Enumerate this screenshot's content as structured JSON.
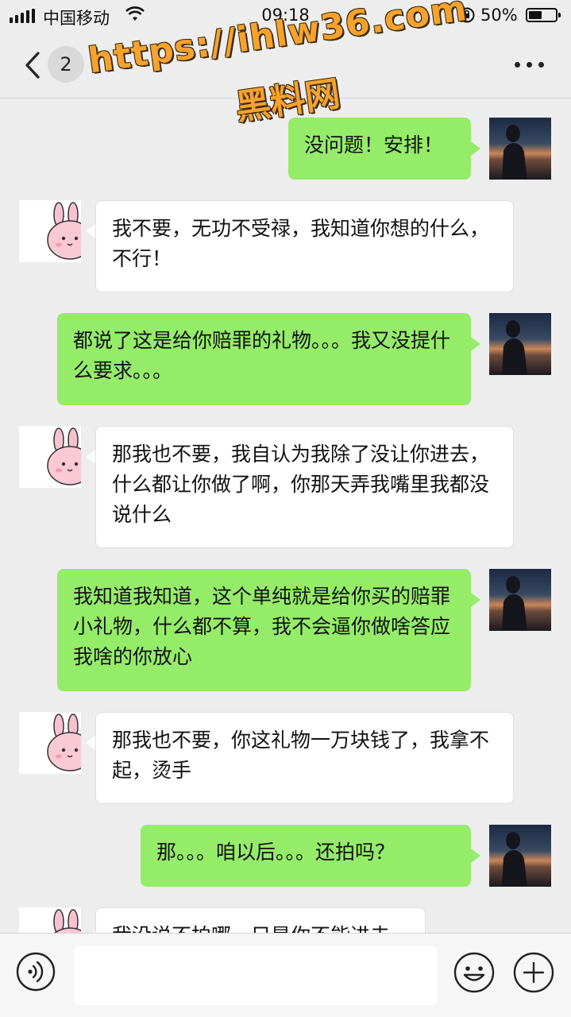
{
  "status_bar": {
    "carrier": "中国移动",
    "time": "09:18",
    "battery_percent": "50%",
    "battery_level": 0.5,
    "icons": [
      "signal-icon",
      "wifi-icon",
      "rotation-lock-icon",
      "battery-icon"
    ]
  },
  "nav": {
    "unread_count": "2",
    "title": "",
    "icons": [
      "back-icon",
      "more-icon"
    ]
  },
  "watermark": {
    "url": "https://ihlw36.com",
    "name": "黑料网",
    "color": "#f6a22d"
  },
  "messages": [
    {
      "from": "me",
      "text": "没问题！安排！"
    },
    {
      "from": "her",
      "text": "我不要，无功不受禄，我知道你想的什么，不行！"
    },
    {
      "from": "me",
      "text": "都说了这是给你赔罪的礼物。。。我又没提什么要求。。。"
    },
    {
      "from": "her",
      "text": "那我也不要，我自认为我除了没让你进去，什么都让你做了啊，你那天弄我嘴里我都没说什么"
    },
    {
      "from": "me",
      "text": "我知道我知道，这个单纯就是给你买的赔罪小礼物，什么都不算，我不会逼你做啥答应我啥的你放心"
    },
    {
      "from": "her",
      "text": "那我也不要，你这礼物一万块钱了，我拿不起，烫手"
    },
    {
      "from": "me",
      "text": "那。。。咱以后。。。还拍吗？"
    },
    {
      "from": "her",
      "text": "我没说不拍哪，只是你不能进去"
    }
  ],
  "input_bar": {
    "placeholder": "",
    "icons": [
      "voice-icon",
      "emoji-icon",
      "plus-icon"
    ]
  },
  "colors": {
    "background": "#ededed",
    "sent_bubble": "#95ec69",
    "received_bubble": "#ffffff"
  }
}
